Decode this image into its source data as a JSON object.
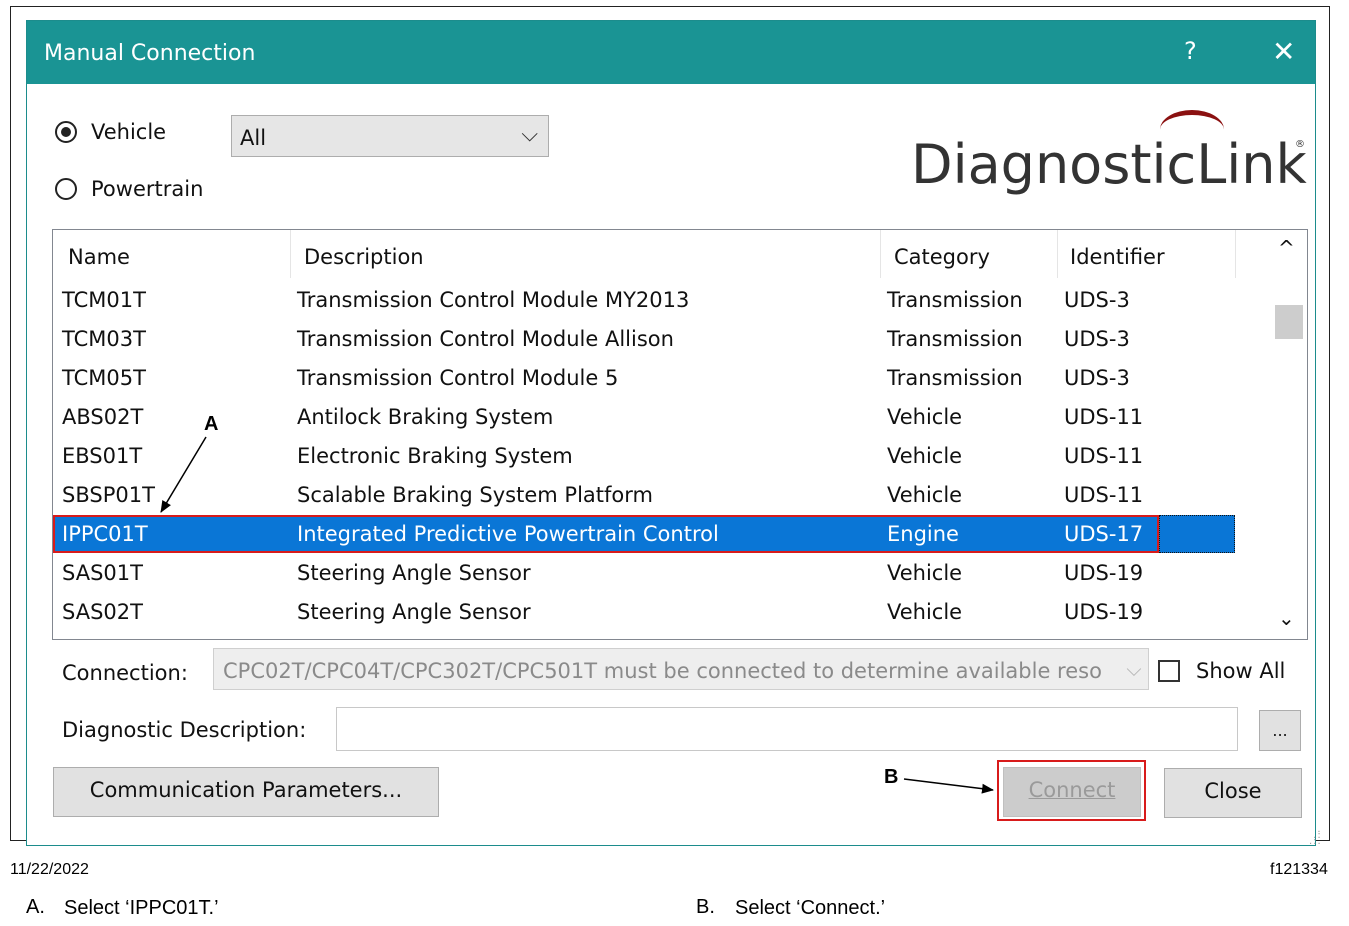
{
  "dialog": {
    "title": "Manual Connection",
    "help_glyph": "?",
    "close_glyph": "✕"
  },
  "filter": {
    "radio_vehicle": "Vehicle",
    "radio_powertrain": "Powertrain",
    "selected_radio": "Vehicle",
    "combo_value": "All",
    "combo_arrow": "⌵"
  },
  "logo": {
    "text": "DiagnosticLink",
    "reg": "®"
  },
  "table": {
    "columns": [
      "Name",
      "Description",
      "Category",
      "Identifier"
    ],
    "rows": [
      [
        "TCM01T",
        "Transmission Control Module MY2013",
        "Transmission",
        "UDS-3"
      ],
      [
        "TCM03T",
        "Transmission Control Module Allison",
        "Transmission",
        "UDS-3"
      ],
      [
        "TCM05T",
        "Transmission Control Module 5",
        "Transmission",
        "UDS-3"
      ],
      [
        "ABS02T",
        "Antilock Braking System",
        "Vehicle",
        "UDS-11"
      ],
      [
        "EBS01T",
        "Electronic Braking System",
        "Vehicle",
        "UDS-11"
      ],
      [
        "SBSP01T",
        "Scalable Braking System Platform",
        "Vehicle",
        "UDS-11"
      ],
      [
        "IPPC01T",
        "Integrated Predictive Powertrain Control",
        "Engine",
        "UDS-17"
      ],
      [
        "SAS01T",
        "Steering Angle Sensor",
        "Vehicle",
        "UDS-19"
      ],
      [
        "SAS02T",
        "Steering Angle Sensor",
        "Vehicle",
        "UDS-19"
      ]
    ],
    "selected_index": 6,
    "scroll_up": "^",
    "scroll_down": "⌄"
  },
  "connection": {
    "label": "Connection:",
    "value": "CPC02T/CPC04T/CPC302T/CPC501T must be connected to determine available reso",
    "arrow": "⌵",
    "show_all_label": "Show All",
    "show_all_checked": false
  },
  "diagnostic": {
    "label": "Diagnostic Description:",
    "value": "",
    "ellipsis": "..."
  },
  "buttons": {
    "comm_params": "Communication Parameters...",
    "connect": "Connect",
    "close": "Close"
  },
  "callouts": {
    "a": "A",
    "b": "B"
  },
  "footer": {
    "date": "11/22/2022",
    "figure_id": "f121334",
    "caption_a_letter": "A.",
    "caption_a_text": "Select ‘IPPC01T.’",
    "caption_b_letter": "B.",
    "caption_b_text": "Select ‘Connect.’"
  }
}
